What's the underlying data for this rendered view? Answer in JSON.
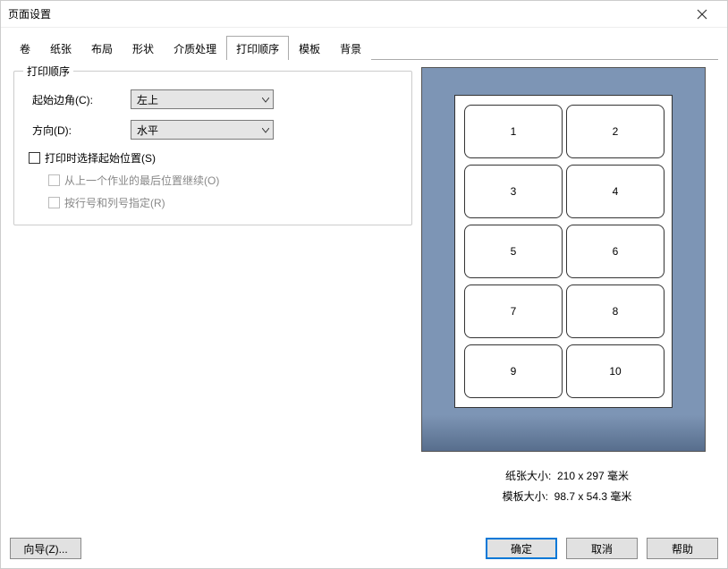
{
  "window": {
    "title": "页面设置"
  },
  "tabs": [
    {
      "label": "卷"
    },
    {
      "label": "纸张"
    },
    {
      "label": "布局"
    },
    {
      "label": "形状"
    },
    {
      "label": "介质处理"
    },
    {
      "label": "打印顺序"
    },
    {
      "label": "模板"
    },
    {
      "label": "背景"
    }
  ],
  "active_tab": 5,
  "group": {
    "title": "打印顺序",
    "start_corner_label": "起始边角(C):",
    "start_corner_value": "左上",
    "direction_label": "方向(D):",
    "direction_value": "水平",
    "checkbox_main": "打印时选择起始位置(S)",
    "checkbox_sub1": "从上一个作业的最后位置继续(O)",
    "checkbox_sub2": "按行号和列号指定(R)"
  },
  "preview": {
    "cells": [
      "1",
      "2",
      "3",
      "4",
      "5",
      "6",
      "7",
      "8",
      "9",
      "10"
    ]
  },
  "info": {
    "paper_label": "纸张大小:",
    "paper_value": "210 x 297 毫米",
    "template_label": "模板大小:",
    "template_value": "98.7 x 54.3 毫米"
  },
  "footer": {
    "wizard": "向导(Z)...",
    "ok": "确定",
    "cancel": "取消",
    "help": "帮助"
  }
}
